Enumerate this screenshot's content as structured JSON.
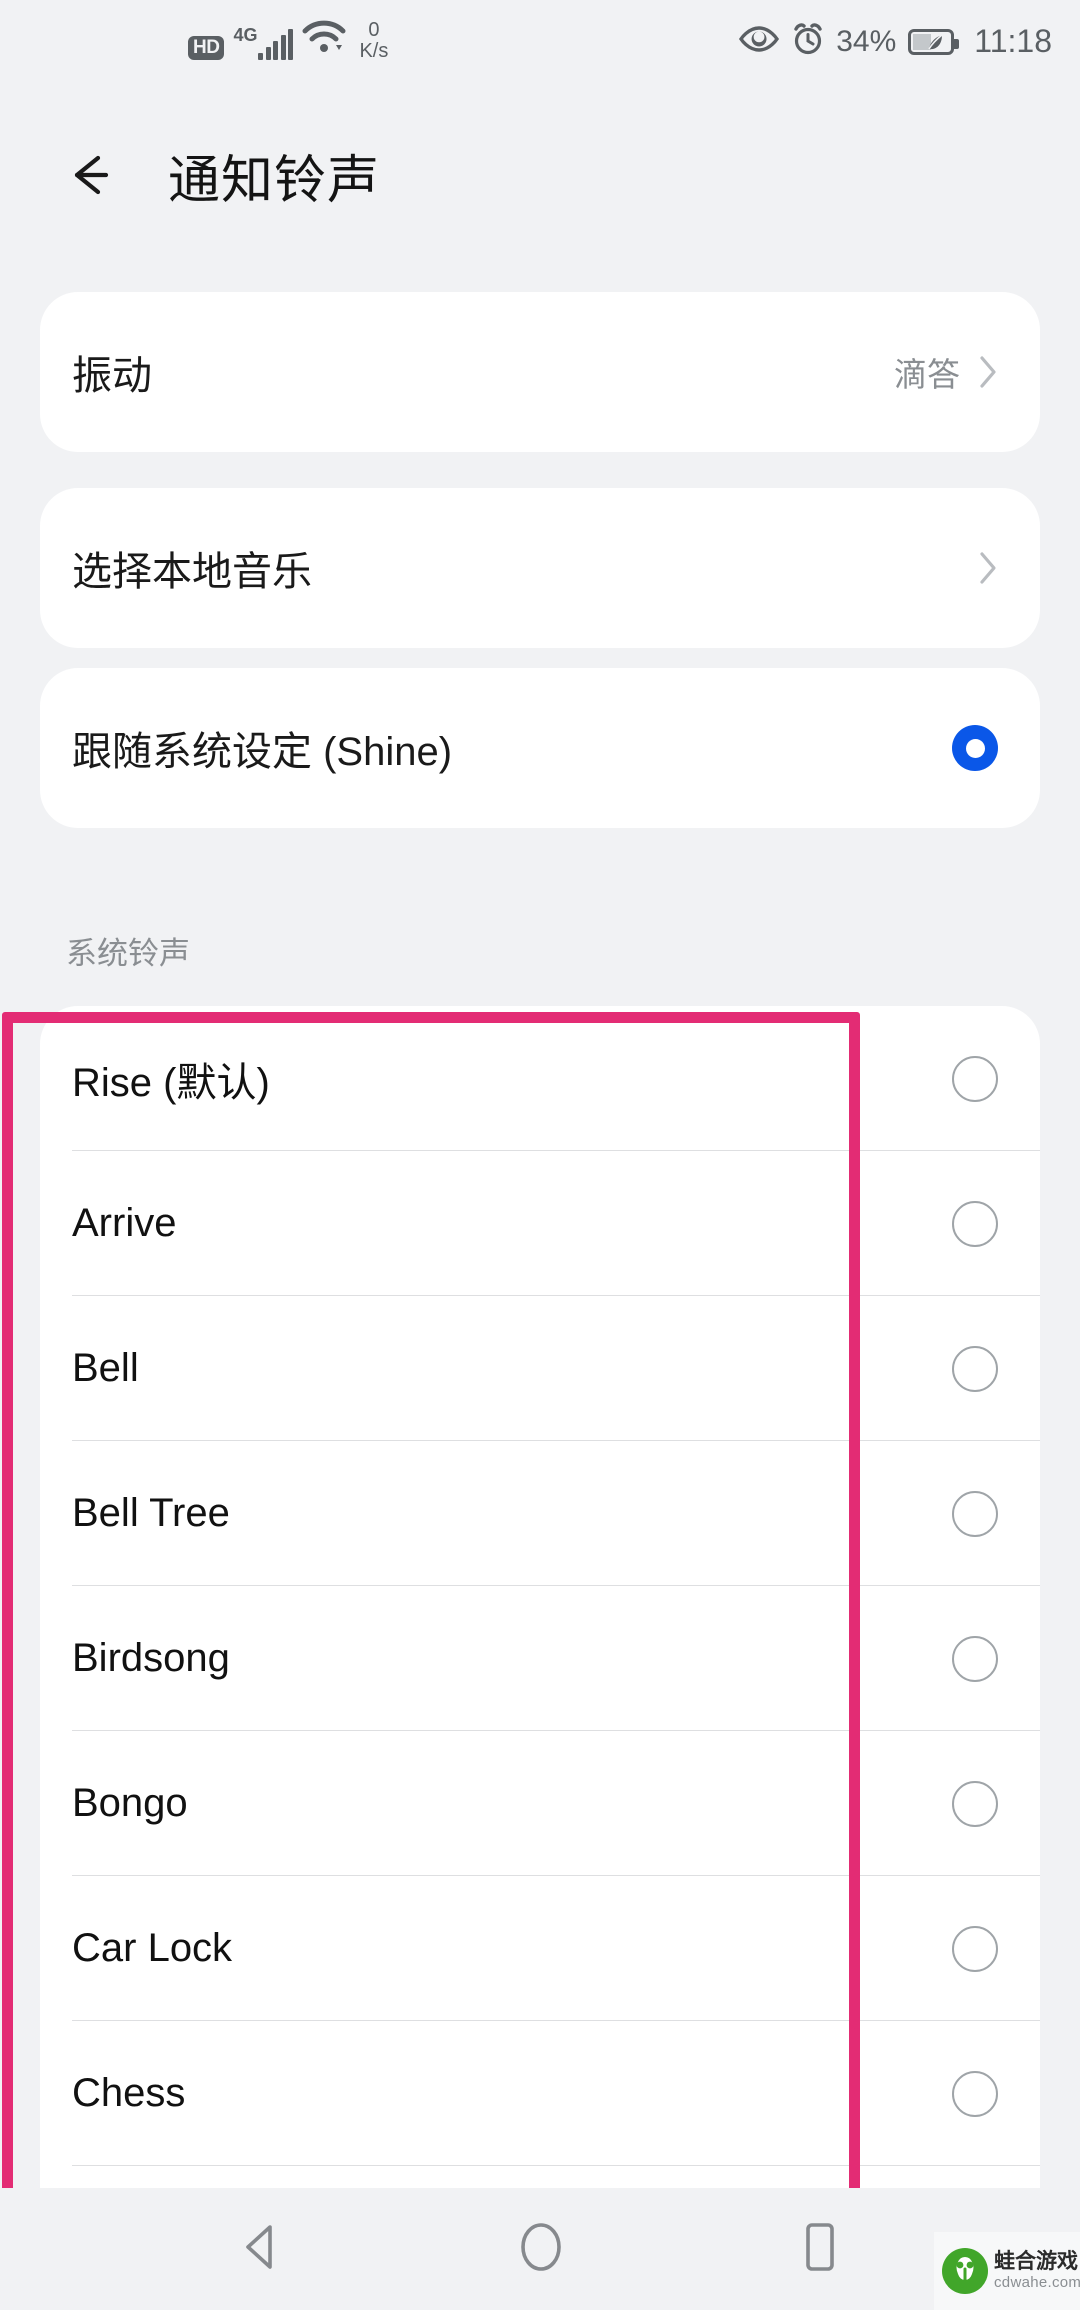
{
  "statusbar": {
    "hd": "HD",
    "network": "4G",
    "data_rate_value": "0",
    "data_rate_unit": "K/s",
    "battery_percent": "34%",
    "time": "11:18",
    "icons": [
      "hd-icon",
      "signal-bars-icon",
      "wifi-icon",
      "eye-comfort-icon",
      "alarm-clock-icon",
      "battery-saver-icon"
    ]
  },
  "header": {
    "back_icon": "back-arrow-icon",
    "title": "通知铃声"
  },
  "settings": [
    {
      "label": "振动",
      "value": "滴答",
      "accessory": "chevron-right-icon"
    },
    {
      "label": "选择本地音乐",
      "value": "",
      "accessory": "chevron-right-icon"
    }
  ],
  "system_option": {
    "label": "跟随系统设定 (Shine)",
    "selected": true,
    "accent_color": "#0a57e8"
  },
  "section": {
    "label": "系统铃声"
  },
  "ringtones": [
    {
      "name": "Rise (默认)",
      "selected": false
    },
    {
      "name": "Arrive",
      "selected": false
    },
    {
      "name": "Bell",
      "selected": false
    },
    {
      "name": "Bell Tree",
      "selected": false
    },
    {
      "name": "Birdsong",
      "selected": false
    },
    {
      "name": "Bongo",
      "selected": false
    },
    {
      "name": "Car Lock",
      "selected": false
    },
    {
      "name": "Chess",
      "selected": false
    }
  ],
  "annotation": {
    "highlight_color": "#e32c74"
  },
  "navbar": {
    "back": "nav-back-icon",
    "home": "nav-home-icon",
    "recents": "nav-recents-icon"
  },
  "watermark": {
    "brand": "蛙合游戏",
    "url": "cdwahe.com"
  }
}
